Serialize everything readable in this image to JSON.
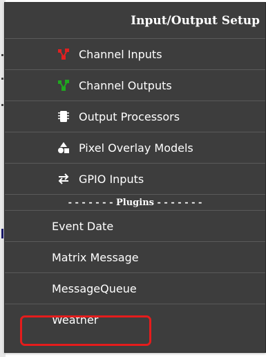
{
  "header": {
    "title": "Input/Output Setup"
  },
  "menu_items": [
    {
      "label": "Channel Inputs",
      "icon": "channel-inputs-icon",
      "color": "#e02020"
    },
    {
      "label": "Channel Outputs",
      "icon": "channel-outputs-icon",
      "color": "#1fa81f"
    },
    {
      "label": "Output Processors",
      "icon": "chip-icon",
      "color": "#ffffff"
    },
    {
      "label": "Pixel Overlay Models",
      "icon": "shapes-icon",
      "color": "#ffffff"
    },
    {
      "label": "GPIO Inputs",
      "icon": "swap-arrows-icon",
      "color": "#ffffff"
    }
  ],
  "divider": {
    "label": "- - - - - - - Plugins - - - - - - -"
  },
  "plugins": [
    {
      "label": "Event Date"
    },
    {
      "label": "Matrix Message"
    },
    {
      "label": "MessageQueue"
    },
    {
      "label": "Weather"
    }
  ],
  "highlight_color": "#e51c1c"
}
